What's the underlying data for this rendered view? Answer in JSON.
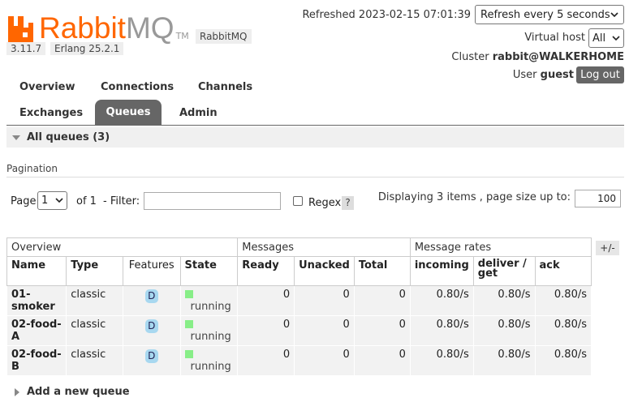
{
  "header": {
    "logo_text_rabbit": "Rabbit",
    "logo_text_mq": "MQ",
    "logo_tm": "TM",
    "product": "RabbitMQ",
    "version": "3.11.7",
    "erlang": "Erlang 25.2.1",
    "refreshed": "Refreshed 2023-02-15 07:01:39",
    "refresh_option": "Refresh every 5 seconds",
    "vhost_label": "Virtual host",
    "vhost_option": "All",
    "cluster_label": "Cluster",
    "cluster_name": "rabbit@WALKERHOME",
    "user_label": "User",
    "user_name": "guest",
    "logout_label": "Log out"
  },
  "tabs": [
    "Overview",
    "Connections",
    "Channels",
    "Exchanges",
    "Queues",
    "Admin"
  ],
  "active_tab": "Queues",
  "section_title": "All queues (3)",
  "pagination": {
    "label": "Pagination",
    "page_label": "Page",
    "page_value": "1",
    "of_label": "of 1",
    "filter_label": "- Filter:",
    "filter_value": "",
    "regex_label": "Regex",
    "help_label": "?",
    "displaying": "Displaying 3 items , page size up to:",
    "page_size": "100"
  },
  "table": {
    "groups": [
      "Overview",
      "Messages",
      "Message rates"
    ],
    "plus_minus": "+/-",
    "columns": [
      "Name",
      "Type",
      "Features",
      "State",
      "Ready",
      "Unacked",
      "Total",
      "incoming",
      "deliver / get",
      "ack"
    ],
    "rows": [
      {
        "name": "01-smoker",
        "type": "classic",
        "feature": "D",
        "state": "running",
        "ready": "0",
        "unacked": "0",
        "total": "0",
        "incoming": "0.80/s",
        "deliver": "0.80/s",
        "ack": "0.80/s"
      },
      {
        "name": "02-food-A",
        "type": "classic",
        "feature": "D",
        "state": "running",
        "ready": "0",
        "unacked": "0",
        "total": "0",
        "incoming": "0.80/s",
        "deliver": "0.80/s",
        "ack": "0.80/s"
      },
      {
        "name": "02-food-B",
        "type": "classic",
        "feature": "D",
        "state": "running",
        "ready": "0",
        "unacked": "0",
        "total": "0",
        "incoming": "0.80/s",
        "deliver": "0.80/s",
        "ack": "0.80/s"
      }
    ]
  },
  "add_queue_label": "Add a new queue",
  "colors": {
    "brand": "#ff6600",
    "tab_active": "#666666",
    "state_running": "#88ee88",
    "feature_badge": "#a8d8f0"
  }
}
